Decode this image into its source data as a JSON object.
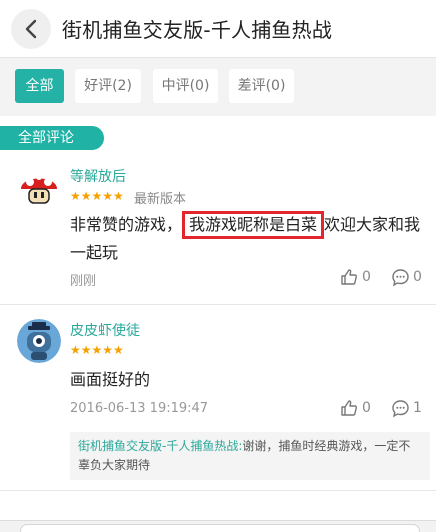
{
  "header": {
    "title": "街机捕鱼交友版-千人捕鱼热战"
  },
  "filters": [
    {
      "label": "全部"
    },
    {
      "label": "好评(2)"
    },
    {
      "label": "中评(0)"
    },
    {
      "label": "差评(0)"
    }
  ],
  "section": {
    "label": "全部评论"
  },
  "comments": [
    {
      "username": "等解放后",
      "stars": "★★★★★",
      "rating": 5,
      "version": "最新版本",
      "text_before": "非常赞的游戏，",
      "text_highlight": "我游戏昵称是白菜",
      "text_after": "欢迎大家和我一起玩",
      "time": "刚刚",
      "likes": "0",
      "replies": "0"
    },
    {
      "username": "皮皮虾使徒",
      "stars": "★★★★★",
      "rating": 5,
      "text": "画面挺好的",
      "time": "2016-06-13 19:19:47",
      "likes": "0",
      "replies": "1",
      "reply": {
        "name": "街机捕鱼交友版-千人捕鱼热战:",
        "text": "谢谢，捕鱼时经典游戏，一定不辜负大家期待"
      }
    }
  ],
  "colors": {
    "accent": "#23b2a5",
    "star": "#f5a100",
    "highlight_border": "#e3262d"
  },
  "icons": [
    "back-icon",
    "thumbs-up-icon",
    "comment-icon",
    "mushroom-avatar",
    "robot-avatar"
  ]
}
